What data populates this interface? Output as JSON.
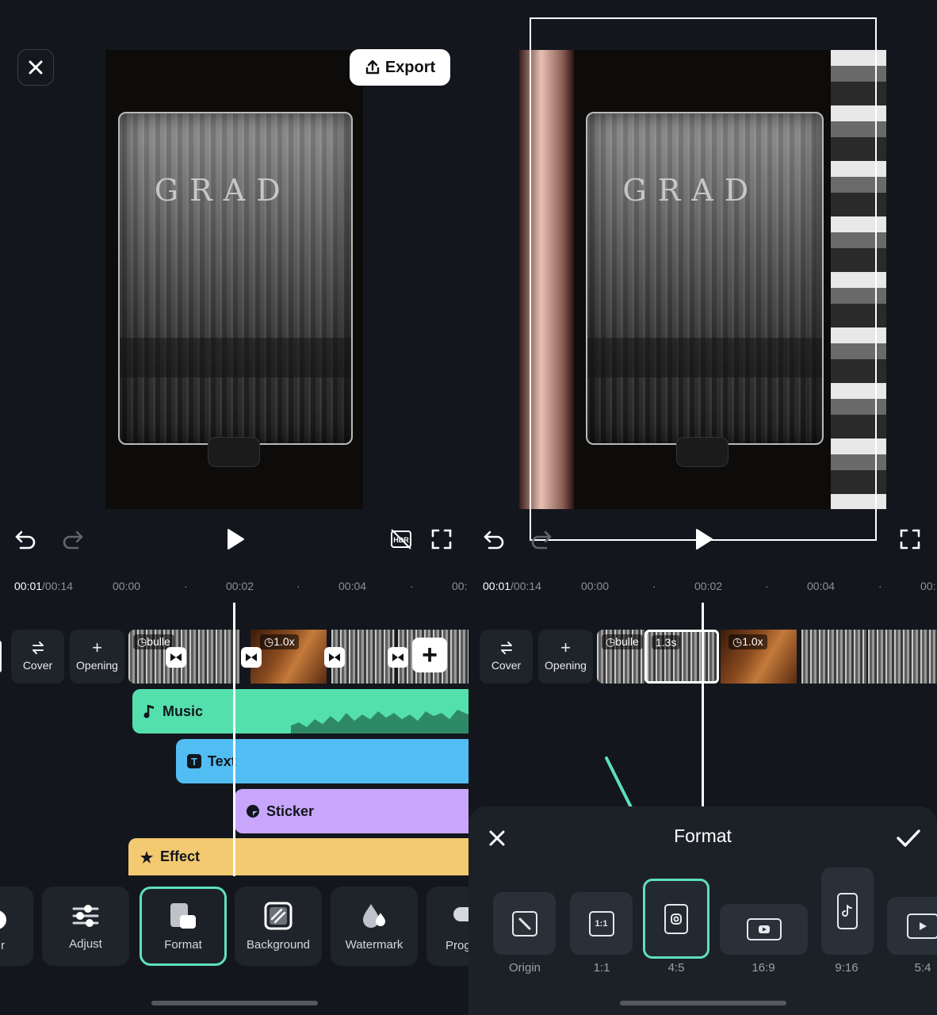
{
  "left": {
    "export_label": "Export",
    "timecode": {
      "current": "00:01",
      "total": "/00:14"
    },
    "ruler": [
      "00:00",
      "00:02",
      "00:04",
      "00:"
    ],
    "tiles": {
      "cover": "Cover",
      "opening": "Opening"
    },
    "clips": {
      "c1": "bulle",
      "c3": "1.0x"
    },
    "tracks": {
      "music": "Music",
      "text": "Text",
      "sticker": "Sticker",
      "effect": "Effect"
    },
    "video_text": "GRAD",
    "tools": [
      {
        "label": "r"
      },
      {
        "label": "Adjust"
      },
      {
        "label": "Format"
      },
      {
        "label": "Background"
      },
      {
        "label": "Watermark"
      },
      {
        "label": "Prog"
      }
    ]
  },
  "right": {
    "timecode": {
      "current": "00:01",
      "total": "/00:14"
    },
    "ruler": [
      "00:00",
      "00:02",
      "00:04",
      "00:"
    ],
    "tiles": {
      "cover": "Cover",
      "opening": "Opening"
    },
    "clips": {
      "c1": "bulle",
      "c2": "1.3s",
      "c3": "1.0x"
    },
    "video_text": "GRAD",
    "sheet": {
      "title": "Format",
      "options": [
        {
          "label": "Origin",
          "icon": "origin-icon"
        },
        {
          "label": "1:1",
          "icon": "square-icon",
          "glyph": "1:1"
        },
        {
          "label": "4:5",
          "icon": "instagram-icon"
        },
        {
          "label": "16:9",
          "icon": "youtube-icon"
        },
        {
          "label": "9:16",
          "icon": "tiktok-icon"
        },
        {
          "label": "5:4",
          "icon": "play-icon"
        }
      ],
      "selected": "4:5"
    }
  },
  "colors": {
    "accent": "#5ee0bc",
    "music": "#54e0ad",
    "text": "#52bdf3",
    "sticker": "#c7a6fb",
    "effect": "#f3c971"
  }
}
